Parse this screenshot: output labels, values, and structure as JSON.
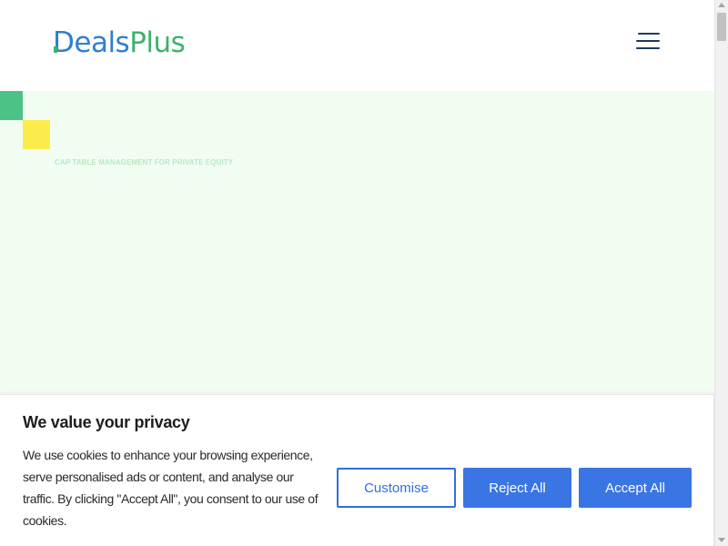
{
  "header": {
    "logo": {
      "part1": "Deals",
      "part2": "Plus"
    },
    "menu_icon": "hamburger-menu-icon"
  },
  "hero": {
    "eyebrow": "CAP TABLE MANAGEMENT FOR PRIVATE EQUITY"
  },
  "cookie_banner": {
    "title": "We value your privacy",
    "text": "We use cookies to enhance your browsing experience, serve personalised ads or content, and analyse our traffic. By clicking \"Accept All\", you consent to our use of cookies.",
    "buttons": {
      "customise": "Customise",
      "reject_all": "Reject All",
      "accept_all": "Accept All"
    }
  },
  "colors": {
    "logo_blue": "#2f7fd3",
    "logo_green": "#3db36b",
    "hero_bg": "#f2fdf2",
    "accent_green": "#4cc287",
    "accent_yellow": "#fbec4b",
    "button_blue": "#3a76e3"
  }
}
